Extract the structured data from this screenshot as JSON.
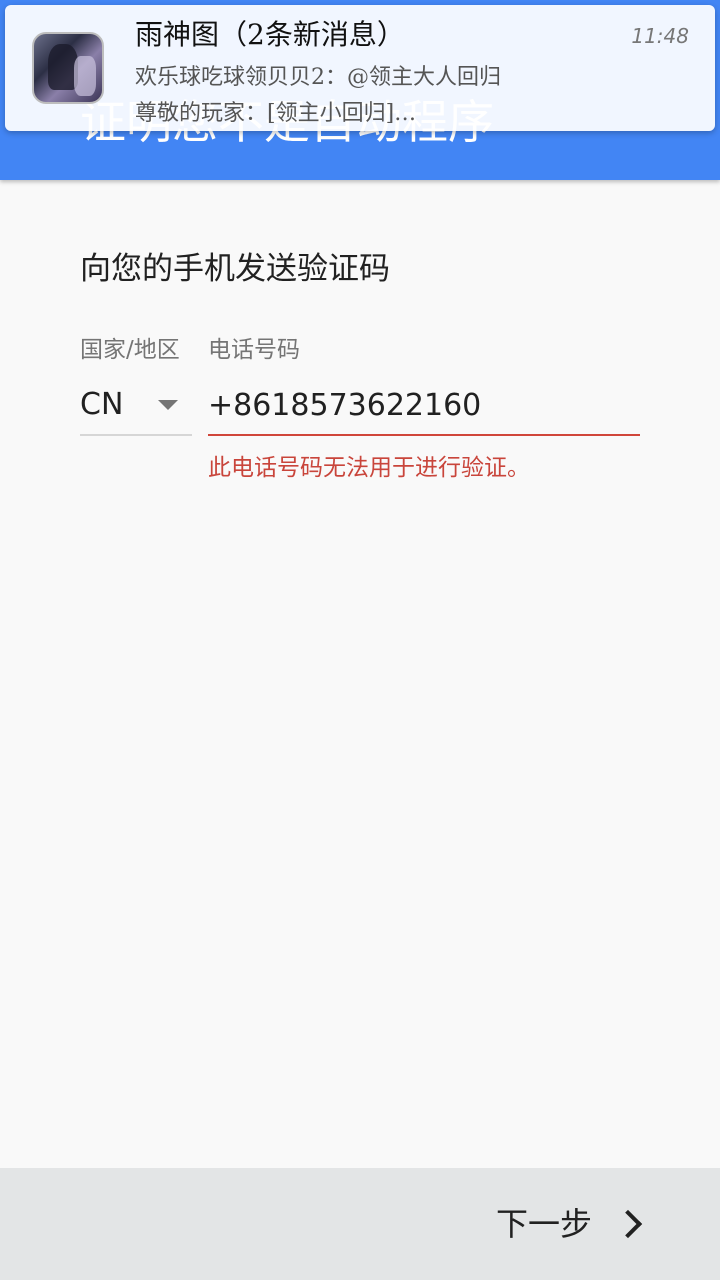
{
  "header": {
    "title": "证明您不是自动程序"
  },
  "notification": {
    "title": "雨神图（2条新消息）",
    "time": "11:48",
    "line1": "欢乐球吃球领贝贝2：@领主大人回归",
    "line2": "尊敬的玩家：[领主小回归]…",
    "avatar_icon": "group-avatar"
  },
  "main": {
    "instruction": "向您的手机发送验证码",
    "country_label": "国家/地区",
    "phone_label": "电话号码",
    "country_value": "CN",
    "phone_value": "+8618573622160",
    "error": "此电话号码无法用于进行验证。",
    "error_color": "#c9453b"
  },
  "footer": {
    "next_label": "下一步",
    "next_icon": "chevron-right-icon"
  },
  "colors": {
    "header_blue": "#4285f4",
    "bottom_bar": "#e3e5e6"
  }
}
